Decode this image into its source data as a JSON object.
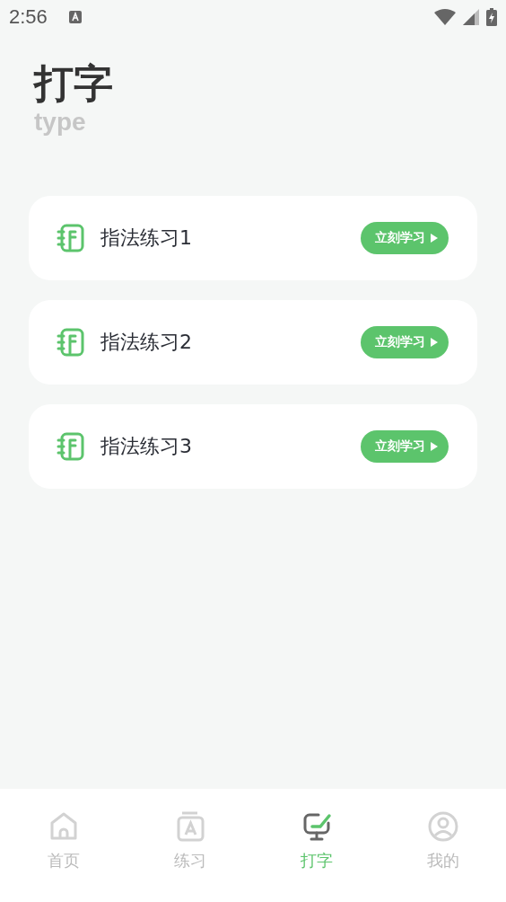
{
  "status_bar": {
    "time": "2:56"
  },
  "header": {
    "title": "打字",
    "subtitle": "type"
  },
  "lessons": [
    {
      "title": "指法练习1",
      "button": "立刻学习"
    },
    {
      "title": "指法练习2",
      "button": "立刻学习"
    },
    {
      "title": "指法练习3",
      "button": "立刻学习"
    }
  ],
  "tabs": [
    {
      "label": "首页",
      "kind": "home",
      "selected": false
    },
    {
      "label": "练习",
      "kind": "book",
      "selected": false
    },
    {
      "label": "打字",
      "kind": "monitor",
      "selected": true
    },
    {
      "label": "我的",
      "kind": "user",
      "selected": false
    }
  ]
}
